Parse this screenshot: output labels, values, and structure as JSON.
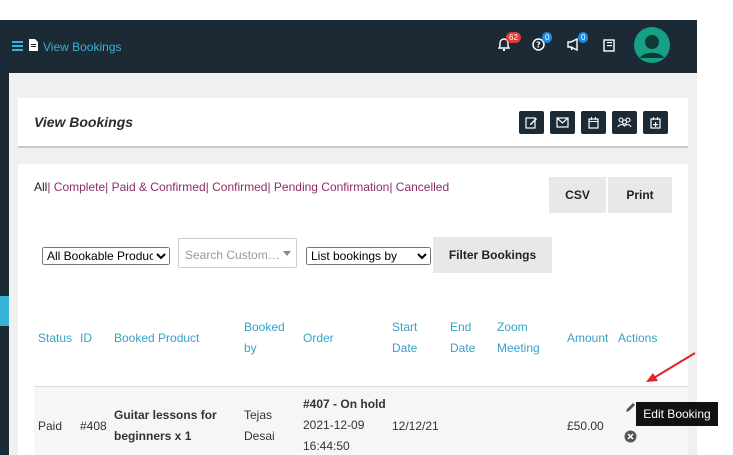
{
  "topbar": {
    "title": "View Bookings",
    "notifications_count": "62",
    "help_count": "0",
    "announcements_count": "0"
  },
  "card": {
    "title": "View Bookings"
  },
  "filters": {
    "all": "All",
    "complete": "| Complete",
    "paid_confirmed": "| Paid & Confirmed",
    "confirmed": "| Confirmed",
    "pending": "| Pending Confirmation",
    "cancelled": "| Cancelled"
  },
  "buttons": {
    "csv": "CSV",
    "print": "Print",
    "filter": "Filter Bookings"
  },
  "controls": {
    "product_select": "All Bookable Products",
    "search_placeholder": "Search Custom…",
    "list_by_select": "List bookings by"
  },
  "table": {
    "headers": {
      "status": "Status",
      "id": "ID",
      "product": "Booked Product",
      "booked_by_1": "Booked",
      "booked_by_2": "by",
      "order": "Order",
      "start_1": "Start",
      "start_2": "Date",
      "end_1": "End",
      "end_2": "Date",
      "zoom_1": "Zoom",
      "zoom_2": "Meeting",
      "amount": "Amount",
      "actions": "Actions"
    },
    "row": {
      "status": "Paid",
      "id": "#408",
      "product_1": "Guitar lessons for",
      "product_2": "beginners x 1",
      "booked_by_1": "Tejas",
      "booked_by_2": "Desai",
      "order_1": "#407 - On hold",
      "order_2": "2021-12-09",
      "order_3": "16:44:50",
      "start": "12/12/21",
      "amount": "£50.00"
    }
  },
  "tooltip": "Edit Booking",
  "colors": {
    "navbar": "#1c2a36",
    "accent": "#36b3d6",
    "link": "#8b2e68",
    "badge_red": "#e53935",
    "badge_blue": "#1e88e5",
    "avatar": "#16a085"
  }
}
